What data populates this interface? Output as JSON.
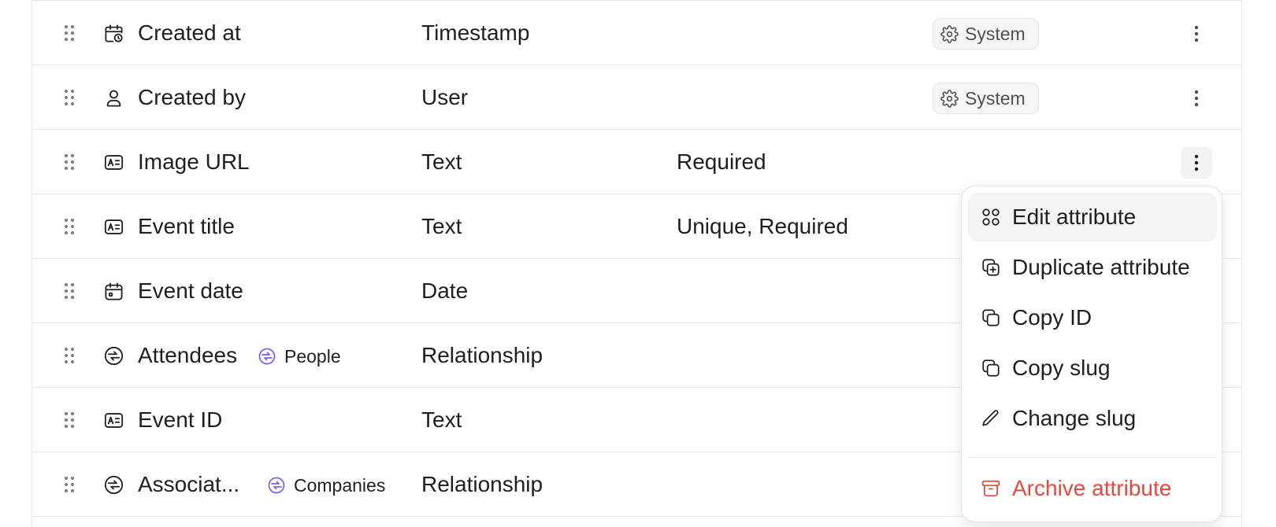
{
  "rows": [
    {
      "name": "Created at",
      "icon": "calendar-clock-icon",
      "type": "Timestamp",
      "constraints": "",
      "badge": "System"
    },
    {
      "name": "Created by",
      "icon": "user-icon",
      "type": "User",
      "constraints": "",
      "badge": "System"
    },
    {
      "name": "Image URL",
      "icon": "text-attribute-icon",
      "type": "Text",
      "constraints": "Required",
      "badge": ""
    },
    {
      "name": "Event title",
      "icon": "text-attribute-icon",
      "type": "Text",
      "constraints": "Unique, Required",
      "badge": ""
    },
    {
      "name": "Event date",
      "icon": "calendar-icon",
      "type": "Date",
      "constraints": "",
      "badge": ""
    },
    {
      "name": "Attendees",
      "icon": "relationship-icon",
      "type": "Relationship",
      "constraints": "",
      "badge": "",
      "related_object": "People"
    },
    {
      "name": "Event ID",
      "icon": "text-attribute-icon",
      "type": "Text",
      "constraints": "",
      "badge": ""
    },
    {
      "name": "Associat...",
      "icon": "relationship-icon",
      "type": "Relationship",
      "constraints": "",
      "badge": "",
      "related_object": "Companies"
    }
  ],
  "context_menu": {
    "items": [
      {
        "label": "Edit attribute",
        "icon": "edit-attribute-icon"
      },
      {
        "label": "Duplicate attribute",
        "icon": "duplicate-icon"
      },
      {
        "label": "Copy ID",
        "icon": "copy-icon"
      },
      {
        "label": "Copy slug",
        "icon": "copy-icon"
      },
      {
        "label": "Change slug",
        "icon": "pencil-icon"
      }
    ],
    "danger_item": {
      "label": "Archive attribute",
      "icon": "archive-icon"
    }
  },
  "colors": {
    "relationship_accent": "#7c5cf5",
    "danger": "#e5483e",
    "border": "#e6e6e6",
    "badge_bg": "#f4f5f4"
  }
}
